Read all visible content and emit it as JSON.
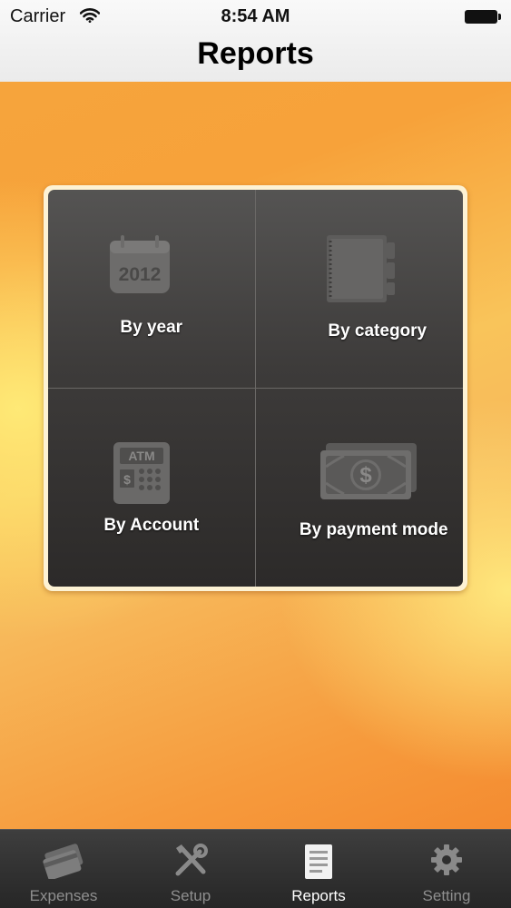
{
  "status_bar": {
    "carrier": "Carrier",
    "time": "8:54 AM"
  },
  "nav": {
    "title": "Reports"
  },
  "report_options": [
    {
      "label": "By year",
      "icon": "calendar-2012-icon",
      "icon_text": "2012"
    },
    {
      "label": "By category",
      "icon": "notebook-icon"
    },
    {
      "label": "By Account",
      "icon": "atm-icon",
      "icon_text": "ATM"
    },
    {
      "label": "By payment mode",
      "icon": "cash-icon",
      "icon_text": "$"
    }
  ],
  "tabs": [
    {
      "label": "Expenses",
      "icon": "credit-card-icon",
      "active": false
    },
    {
      "label": "Setup",
      "icon": "tools-icon",
      "active": false
    },
    {
      "label": "Reports",
      "icon": "document-icon",
      "active": true
    },
    {
      "label": "Setting",
      "icon": "gear-icon",
      "active": false
    }
  ],
  "colors": {
    "background_orange": "#f6a43c",
    "background_yellow": "#ffec78",
    "panel_dark": "#3d3b3a",
    "tabbar": "#2f2f2f",
    "tab_active": "#ffffff",
    "tab_inactive": "#8f8f8f"
  }
}
